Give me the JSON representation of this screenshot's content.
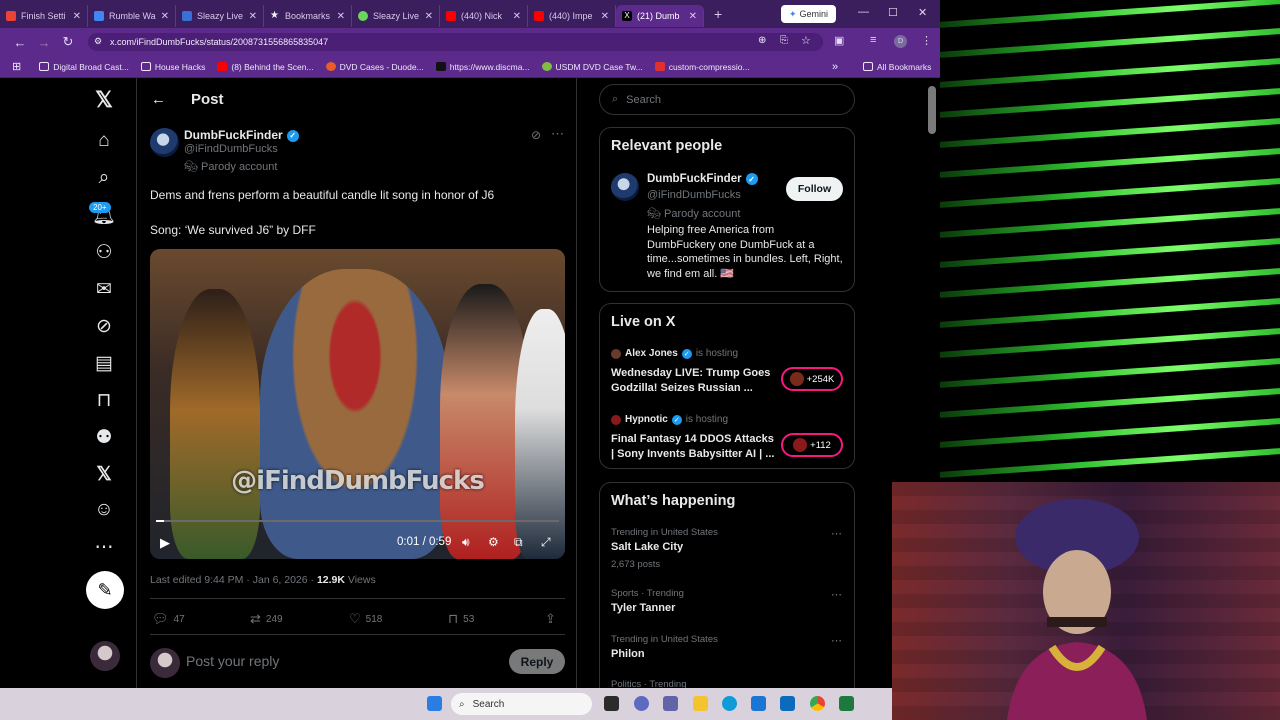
{
  "browser": {
    "tabs": [
      {
        "label": "Finish Setti",
        "color": "#ea4335"
      },
      {
        "label": "Rumble Wa",
        "color": "#4285f4"
      },
      {
        "label": "Sleazy Live",
        "color": "#3b6fd8"
      },
      {
        "label": "Bookmarks",
        "color": "#f4f4f4"
      },
      {
        "label": "Sleazy Live",
        "color": "#6bd45b"
      },
      {
        "label": "(440) Nick",
        "color": "#ff0000"
      },
      {
        "label": "(440) Impe",
        "color": "#ff0000"
      },
      {
        "label": "(21) Dumb",
        "color": "#000000"
      }
    ],
    "gemini_label": "Gemini",
    "url": "x.com/iFindDumbFucks/status/2008731556865835047",
    "avatar_letter": "D",
    "bookmarks": [
      "Digital Broad Cast...",
      "House Hacks",
      "(8) Behind the Scen...",
      "DVD Cases - Duode...",
      "https://www.discma...",
      "USDM DVD Case Tw...",
      "custom-compressio..."
    ],
    "all_bookmarks": "All Bookmarks"
  },
  "nav": {
    "notif_badge": "20+"
  },
  "post": {
    "header_title": "Post",
    "author_name": "DumbFuckFinder",
    "author_handle": "@iFindDumbFucks",
    "parody_label": "Parody account",
    "text_line1": "Dems and frens perform a beautiful candle lit song in honor of J6",
    "text_line2": "Song: ‘We survived J6” by DFF",
    "video_watermark": "@iFindDumbFucks",
    "video_time": "0:01 / 0:59",
    "video_progress": 0.02,
    "meta_edited": "Last edited 9:44 PM · Jan 6, 2026 · ",
    "meta_views_count": "12.9K",
    "meta_views_label": " Views",
    "replies": "47",
    "reposts": "249",
    "likes": "518",
    "bookmarks": "53",
    "reply_placeholder": "Post your reply",
    "reply_button": "Reply"
  },
  "sidebar": {
    "search_placeholder": "Search",
    "relevant_title": "Relevant people",
    "rel_name": "DumbFuckFinder",
    "rel_handle": "@iFindDumbFucks",
    "rel_parody": "Parody account",
    "follow_label": "Follow",
    "rel_bio": "Helping free America from DumbFuckery one DumbFuck at a time...sometimes in bundles. Left, Right, we find em all. 🇺🇸",
    "live_title": "Live on X",
    "live": [
      {
        "host": "Alex Jones",
        "hosting": "is hosting",
        "title": "Wednesday LIVE: Trump Goes Godzilla! Seizes Russian ...",
        "count": "+254K"
      },
      {
        "host": "Hypnotic",
        "hosting": "is hosting",
        "title": "Final Fantasy 14 DDOS Attacks | Sony Invents Babysitter AI | ...",
        "count": "+112"
      }
    ],
    "happening_title": "What’s happening",
    "trends": [
      {
        "context": "Trending in United States",
        "title": "Salt Lake City",
        "count": "2,673 posts"
      },
      {
        "context": "Sports · Trending",
        "title": "Tyler Tanner",
        "count": ""
      },
      {
        "context": "Trending in United States",
        "title": "Philon",
        "count": ""
      },
      {
        "context": "Politics · Trending",
        "title": "",
        "count": ""
      }
    ]
  },
  "taskbar": {
    "search_label": "Search"
  }
}
